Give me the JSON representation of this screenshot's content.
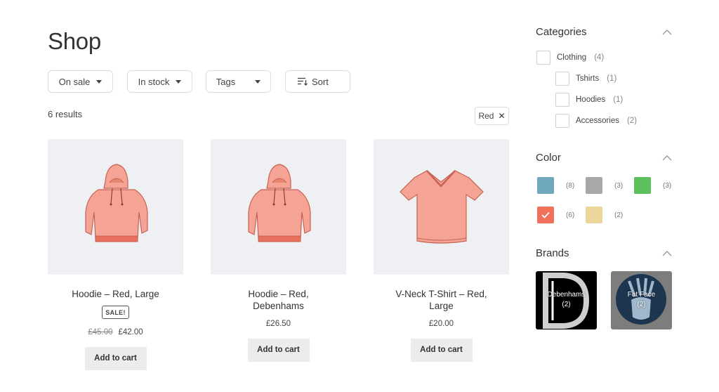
{
  "page": {
    "title": "Shop"
  },
  "filters": {
    "on_sale": "On sale",
    "in_stock": "In stock",
    "tags": "Tags",
    "sort": "Sort"
  },
  "results": {
    "count_text": "6 results"
  },
  "active_filter": {
    "label": "Red",
    "remove_glyph": "✕"
  },
  "products": [
    {
      "name": "Hoodie – Red, Large",
      "on_sale": true,
      "sale_badge": "SALE!",
      "price_old": "£45.00",
      "price": "£42.00",
      "button": "Add to cart",
      "icon": "hoodie-icon"
    },
    {
      "name": "Hoodie – Red, Debenhams",
      "on_sale": false,
      "price": "£26.50",
      "button": "Add to cart",
      "icon": "hoodie-icon"
    },
    {
      "name": "V-Neck T-Shirt – Red, Large",
      "on_sale": false,
      "price": "£20.00",
      "button": "Add to cart",
      "icon": "tshirt-icon"
    }
  ],
  "sidebar": {
    "categories": {
      "heading": "Categories",
      "items": [
        {
          "label": "Clothing",
          "count": "(4)",
          "level": 0
        },
        {
          "label": "Tshirts",
          "count": "(1)",
          "level": 1
        },
        {
          "label": "Hoodies",
          "count": "(1)",
          "level": 1
        },
        {
          "label": "Accessories",
          "count": "(2)",
          "level": 1
        }
      ]
    },
    "color": {
      "heading": "Color",
      "swatches": [
        {
          "color": "#6fa8bd",
          "count": "(8)",
          "selected": false
        },
        {
          "color": "#a8a8a8",
          "count": "(3)",
          "selected": false
        },
        {
          "color": "#5cc05c",
          "count": "(3)",
          "selected": false
        },
        {
          "color": "#f0705a",
          "count": "(6)",
          "selected": true
        },
        {
          "color": "#ecd59a",
          "count": "(2)",
          "selected": false
        }
      ]
    },
    "brands": {
      "heading": "Brands",
      "items": [
        {
          "name": "Debenhams",
          "count": "(2)",
          "logo": "debenhams-logo"
        },
        {
          "name": "Fat Face",
          "count": "(2)",
          "logo": "fat-face-logo"
        }
      ]
    }
  },
  "colors": {
    "text": "#333333",
    "product_bg": "#eef0f3",
    "garment": "#f4a394",
    "garment_dark": "#e8705c",
    "button_bg": "#ececec"
  }
}
